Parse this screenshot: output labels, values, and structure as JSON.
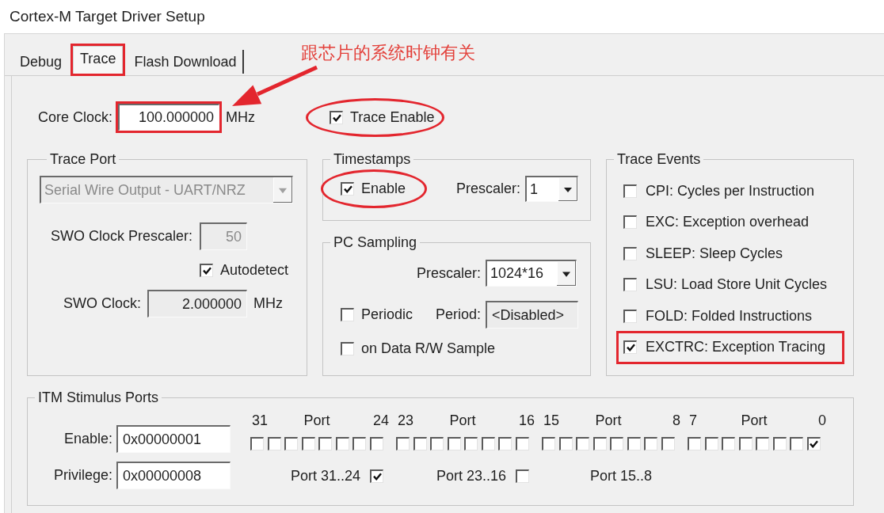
{
  "window": {
    "title": "Cortex-M Target Driver Setup"
  },
  "tabs": [
    {
      "label": "Debug",
      "selected": false,
      "boxed": false
    },
    {
      "label": "Trace",
      "selected": true,
      "boxed": true
    },
    {
      "label": "Flash Download",
      "selected": false,
      "boxed": false
    }
  ],
  "callout": {
    "text": "跟芯片的系统时钟有关"
  },
  "core_clock": {
    "label": "Core Clock:",
    "value": "100.000000",
    "unit": "MHz",
    "boxed": true
  },
  "trace_enable": {
    "label": "Trace Enable",
    "checked": true,
    "circled": true
  },
  "trace_port": {
    "title": "Trace Port",
    "dropdown": {
      "value": "Serial Wire Output - UART/NRZ",
      "disabled": true
    },
    "swo_clock_prescaler": {
      "label": "SWO Clock Prescaler:",
      "value": "50",
      "disabled": true
    },
    "autodetect": {
      "label": "Autodetect",
      "checked": true
    },
    "swo_clock": {
      "label": "SWO Clock:",
      "value": "2.000000",
      "unit": "MHz",
      "read_only": true
    }
  },
  "timestamps": {
    "title": "Timestamps",
    "enable": {
      "label": "Enable",
      "checked": true,
      "circled": true
    },
    "prescaler": {
      "label": "Prescaler:",
      "value": "1",
      "disabled": false
    }
  },
  "pc_sampling": {
    "title": "PC Sampling",
    "prescaler": {
      "label": "Prescaler:",
      "value": "1024*16",
      "disabled": false
    },
    "periodic": {
      "label": "Periodic",
      "checked": false
    },
    "period": {
      "label": "Period:",
      "value": "<Disabled>",
      "read_only": true
    },
    "on_data_rw_sample": {
      "label": "on Data R/W Sample",
      "checked": false
    }
  },
  "trace_events": {
    "title": "Trace Events",
    "items": [
      {
        "label": "CPI: Cycles per Instruction",
        "checked": false,
        "boxed": false
      },
      {
        "label": "EXC: Exception overhead",
        "checked": false,
        "boxed": false
      },
      {
        "label": "SLEEP: Sleep Cycles",
        "checked": false,
        "boxed": false
      },
      {
        "label": "LSU: Load Store Unit Cycles",
        "checked": false,
        "boxed": false
      },
      {
        "label": "FOLD: Folded Instructions",
        "checked": false,
        "boxed": false
      },
      {
        "label": "EXCTRC: Exception Tracing",
        "checked": true,
        "boxed": true
      }
    ]
  },
  "itm_stimulus_ports": {
    "title": "ITM Stimulus Ports",
    "enable": {
      "label": "Enable:",
      "value": "0x00000001"
    },
    "privilege": {
      "label": "Privilege:",
      "value": "0x00000008"
    },
    "port_groups": [
      {
        "high": "31",
        "caption": "Port",
        "low": "24",
        "bits": [
          {
            "checked": false
          },
          {
            "checked": false
          },
          {
            "checked": false
          },
          {
            "checked": false
          },
          {
            "checked": false
          },
          {
            "checked": false
          },
          {
            "checked": false
          },
          {
            "checked": false
          }
        ]
      },
      {
        "high": "23",
        "caption": "Port",
        "low": "16",
        "bits": [
          {
            "checked": false
          },
          {
            "checked": false
          },
          {
            "checked": false
          },
          {
            "checked": false
          },
          {
            "checked": false
          },
          {
            "checked": false
          },
          {
            "checked": false
          },
          {
            "checked": false
          }
        ]
      },
      {
        "high": "15",
        "caption": "Port",
        "low": "8",
        "bits": [
          {
            "checked": false
          },
          {
            "checked": false
          },
          {
            "checked": false
          },
          {
            "checked": false
          },
          {
            "checked": false
          },
          {
            "checked": false
          },
          {
            "checked": false
          },
          {
            "checked": false
          }
        ]
      },
      {
        "high": "7",
        "caption": "Port",
        "low": "0",
        "bits": [
          {
            "checked": false
          },
          {
            "checked": false
          },
          {
            "checked": false
          },
          {
            "checked": false
          },
          {
            "checked": false
          },
          {
            "checked": false
          },
          {
            "checked": false
          },
          {
            "checked": true
          }
        ]
      }
    ],
    "privilege_groups": [
      {
        "kind": "checkbox",
        "label": "Port 31..24",
        "checked": true
      },
      {
        "kind": "checkbox",
        "label": "Port 23..16",
        "checked": false
      },
      {
        "kind": "label",
        "label": "Port 15..8"
      }
    ]
  }
}
